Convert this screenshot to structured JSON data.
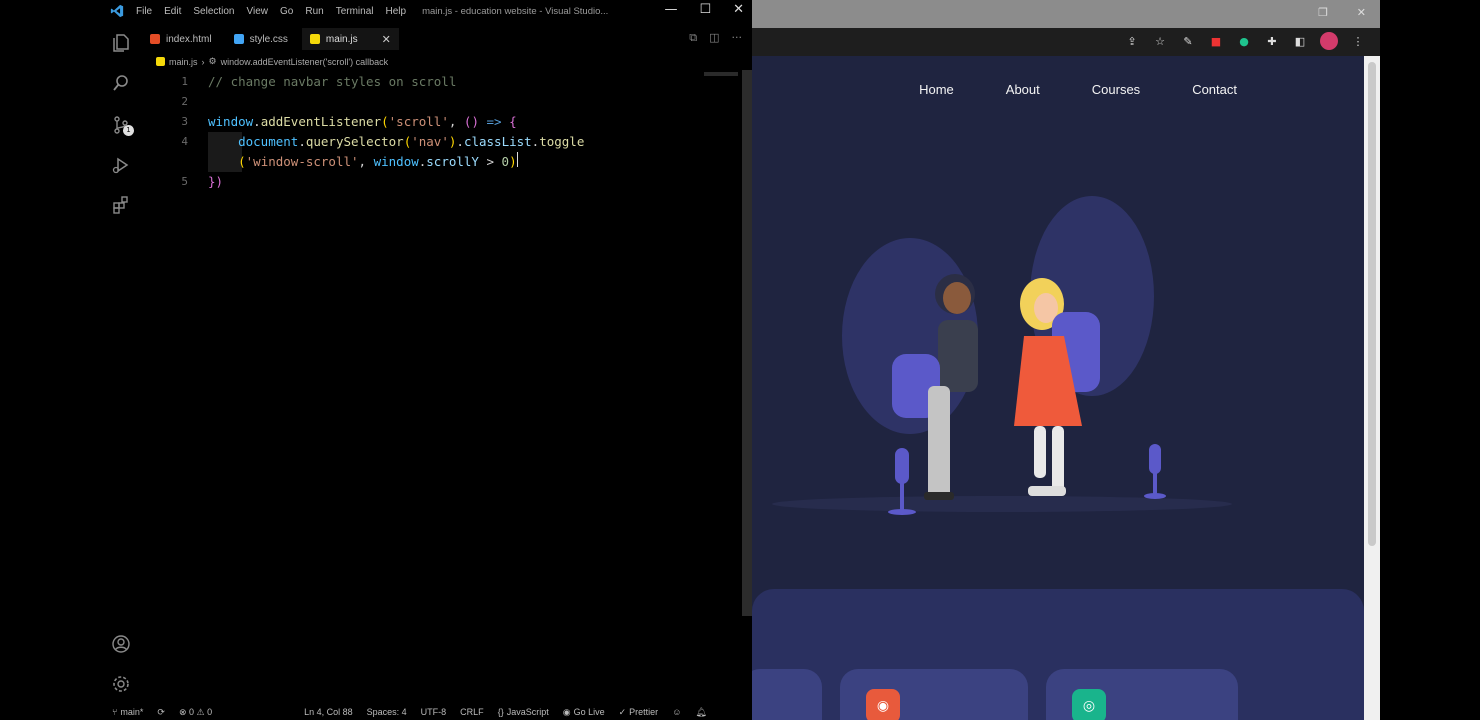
{
  "vscode": {
    "menu": [
      "File",
      "Edit",
      "Selection",
      "View",
      "Go",
      "Run",
      "Terminal",
      "Help"
    ],
    "window_title": "main.js - education website - Visual Studio...",
    "tabs": [
      {
        "label": "index.html",
        "color": "#e44d26"
      },
      {
        "label": "style.css",
        "color": "#42a5f5"
      },
      {
        "label": "main.js",
        "color": "#f5d90a"
      }
    ],
    "breadcrumb": {
      "file": "main.js",
      "symbol": "window.addEventListener('scroll') callback"
    },
    "source_control_badge": "1",
    "code": {
      "line_numbers": [
        "1",
        "2",
        "3",
        "4",
        "",
        "5"
      ],
      "l1": "// change navbar styles on scroll",
      "l3_obj": "window",
      "l3_dot": ".",
      "l3_fn": "addEventListener",
      "l3_open": "(",
      "l3_str": "'scroll'",
      "l3_comma": ", ",
      "l3_paren": "()",
      "l3_arrow": " => ",
      "l3_brace": "{",
      "l4_obj": "document",
      "l4_dot": ".",
      "l4_fn": "querySelector",
      "l4_open": "(",
      "l4_str": "'nav'",
      "l4_close": ")",
      "l4_dot2": ".",
      "l4_prop": "classList",
      "l4_dot3": ".",
      "l4_fn2": "toggle",
      "l4b_open": "(",
      "l4b_str": "'window-scroll'",
      "l4b_comma": ", ",
      "l4b_obj": "window",
      "l4b_dot": ".",
      "l4b_prop": "scrollY",
      "l4b_op": " > ",
      "l4b_num": "0",
      "l4b_close": ")",
      "l5_close": "})"
    },
    "status": {
      "branch": "main*",
      "problems": "⊗ 0 ⚠ 0",
      "position": "Ln 4, Col 88",
      "spaces": "Spaces: 4",
      "encoding": "UTF-8",
      "eol": "CRLF",
      "language": "JavaScript",
      "golive": "Go Live",
      "prettier": "Prettier"
    }
  },
  "browser": {
    "nav": [
      "Home",
      "About",
      "Courses",
      "Contact"
    ],
    "colors": {
      "page_bg": "#1f2440",
      "accent": "#5b59c9",
      "card_red": "#e85a3c",
      "card_green": "#19b48c"
    }
  }
}
